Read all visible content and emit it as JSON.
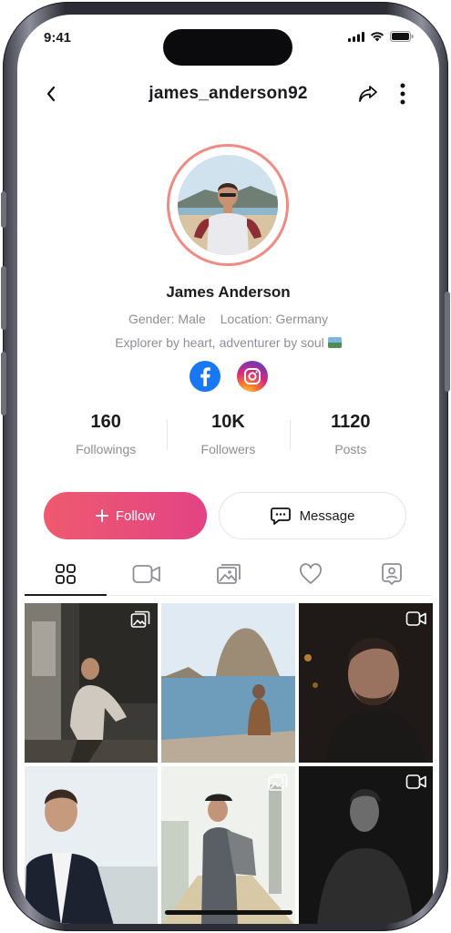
{
  "status_bar": {
    "time": "9:41"
  },
  "header": {
    "username": "james_anderson92"
  },
  "profile": {
    "name": "James Anderson",
    "gender": "Gender: Male",
    "location": "Location: Germany",
    "bio": "Explorer by heart, adventurer by soul"
  },
  "stats": [
    {
      "value": "160",
      "label": "Followings"
    },
    {
      "value": "10K",
      "label": "Followers"
    },
    {
      "value": "1120",
      "label": "Posts"
    }
  ],
  "actions": {
    "follow_label": "Follow",
    "message_label": "Message"
  },
  "tabs": [
    "grid-icon",
    "video-icon",
    "photos-icon",
    "heart-icon",
    "tagged-icon"
  ],
  "colors": {
    "accent_start": "#ee5a6f",
    "accent_end": "#e34384",
    "ring": "#ef8b83"
  },
  "posts": [
    {
      "type": "photo",
      "icon": "gallery-icon"
    },
    {
      "type": "photo",
      "icon": ""
    },
    {
      "type": "video",
      "icon": "video-icon"
    },
    {
      "type": "photo",
      "icon": ""
    },
    {
      "type": "photo",
      "icon": "gallery-icon"
    },
    {
      "type": "video",
      "icon": "video-icon"
    }
  ]
}
